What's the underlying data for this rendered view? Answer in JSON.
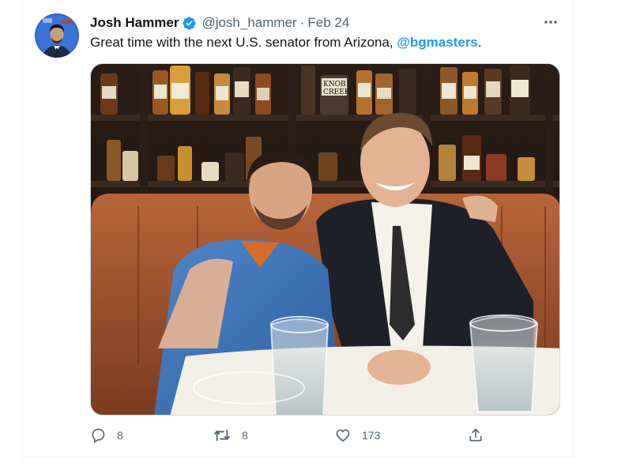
{
  "author": {
    "name": "Josh Hammer",
    "handle": "@josh_hammer",
    "separator": "·",
    "date": "Feb 24",
    "verified": true
  },
  "tweet": {
    "text_before": "Great time with the next U.S. senator from Arizona, ",
    "mention": "@bgmasters",
    "text_after": "."
  },
  "stats": {
    "replies": "8",
    "retweets": "8",
    "likes": "173"
  },
  "icons": {
    "verified": "verified-badge-icon",
    "more": "more-options-icon",
    "reply": "reply-icon",
    "retweet": "retweet-icon",
    "like": "heart-icon",
    "share": "share-icon"
  },
  "colors": {
    "accent": "#1d9bf0",
    "text_primary": "#0f1419",
    "text_secondary": "#536471"
  }
}
